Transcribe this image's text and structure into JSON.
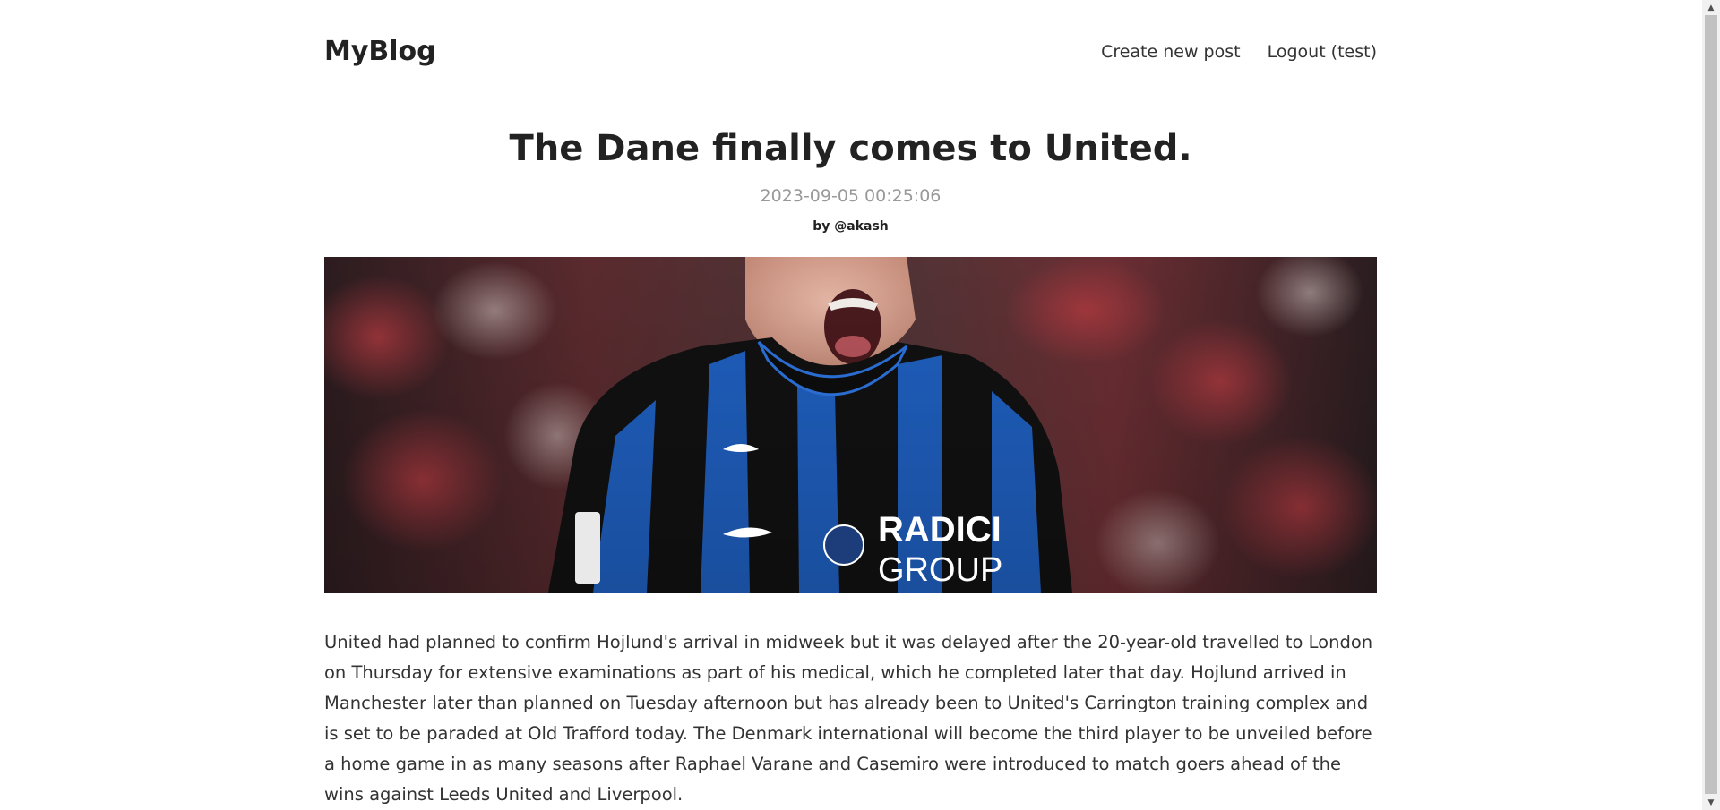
{
  "brand": "MyBlog",
  "nav": {
    "create_post": "Create new post",
    "logout": "Logout (test)"
  },
  "post": {
    "title": "The Dane finally comes to United.",
    "date": "2023-09-05 00:25:06",
    "author": "by @akash",
    "image_jersey_text": "RADICI GROUP",
    "body": "United had planned to confirm Hojlund's arrival in midweek but it was delayed after the 20-year-old travelled to London on Thursday for extensive examinations as part of his medical, which he completed later that day. Hojlund arrived in Manchester later than planned on Tuesday afternoon but has already been to United's Carrington training complex and is set to be paraded at Old Trafford today. The Denmark international will become the third player to be unveiled before a home game in as many seasons after Raphael Varane and Casemiro were introduced to match goers ahead of the wins against Leeds United and Liverpool."
  },
  "colors": {
    "text": "#222222",
    "muted": "#999999",
    "jersey_blue": "#1f5fbf",
    "jersey_black": "#111111",
    "crowd_red": "#8a2a30"
  }
}
